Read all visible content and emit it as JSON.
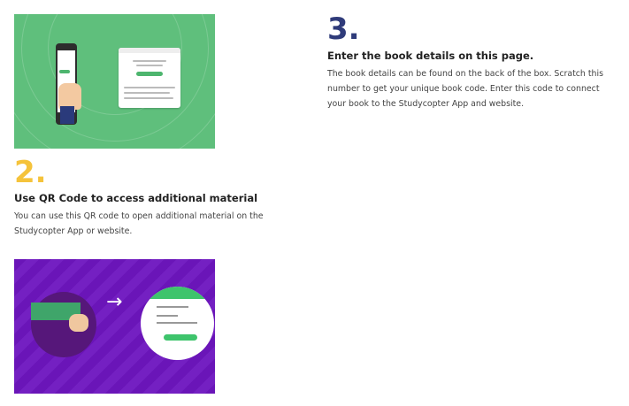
{
  "step2": {
    "number": "2.",
    "heading": "Use QR Code to access additional material",
    "text": "You can use this QR code to open additional material on the Studycopter App or website."
  },
  "step3": {
    "number": "3.",
    "heading": "Enter the book details on this page.",
    "text": "The book details can be found on the back of the box.  Scratch this number to get your unique book code. Enter this code to connect your book to the Studycopter App and website."
  },
  "colors": {
    "step2_number": "#f5c33b",
    "step3_number": "#2f3b7a",
    "green_panel": "#5fbf7c",
    "purple_panel": "#6a15b8"
  }
}
